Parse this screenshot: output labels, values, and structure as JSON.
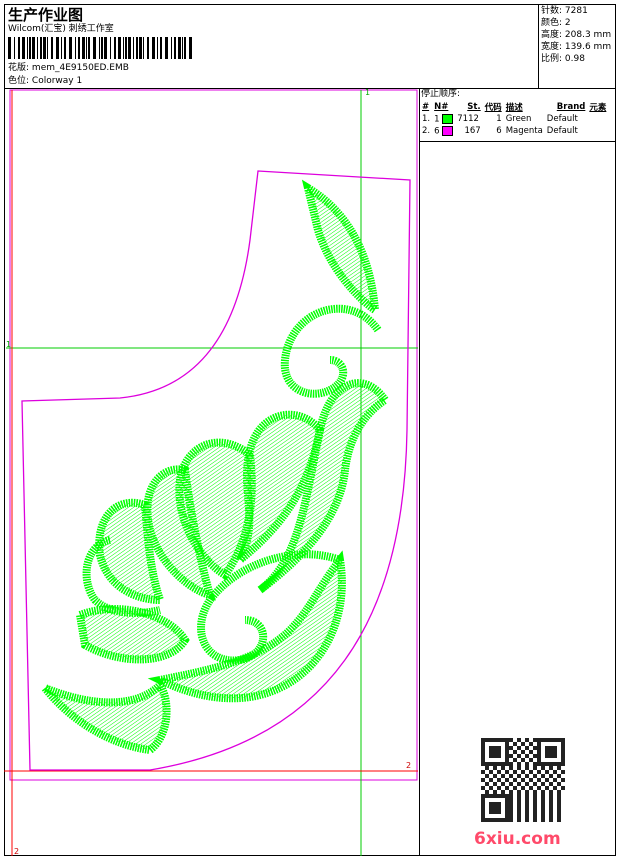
{
  "header": {
    "title": "生产作业图",
    "company": "Wilcom(汇宝) 刺绣工作室",
    "design_label": "花版:",
    "design_value": "mem_4E9150ED.EMB",
    "colorway_label": "色位:",
    "colorway_value": "Colorway 1"
  },
  "stats": [
    {
      "label": "针数:",
      "value": "7281"
    },
    {
      "label": "颜色:",
      "value": "2"
    },
    {
      "label": "高度:",
      "value": "208.3 mm"
    },
    {
      "label": "宽度:",
      "value": "139.6 mm"
    },
    {
      "label": "比例:",
      "value": "0.98"
    }
  ],
  "stop_sequence": {
    "title": "停止顺序:",
    "headers": [
      "#",
      "N#",
      "St.",
      "代码",
      "描述",
      "Brand",
      "元素"
    ],
    "rows": [
      {
        "no": "1.",
        "needle": "1",
        "color": "#00ff00",
        "stitches": "7112",
        "code": "1",
        "desc": "Green",
        "brand": "Default"
      },
      {
        "no": "2.",
        "needle": "6",
        "color": "#ff00ff",
        "stitches": "167",
        "code": "6",
        "desc": "Magenta",
        "brand": "Default"
      }
    ]
  },
  "guides": {
    "v1_label": "1",
    "h1_label": "1",
    "h2_label": "2",
    "v2_label": "2"
  },
  "watermark": {
    "site": "6xiu.com"
  },
  "colors": {
    "green": "#00ff00",
    "magenta": "#e000e0",
    "guide_green": "#00cc00",
    "guide_red": "#ff0000"
  }
}
